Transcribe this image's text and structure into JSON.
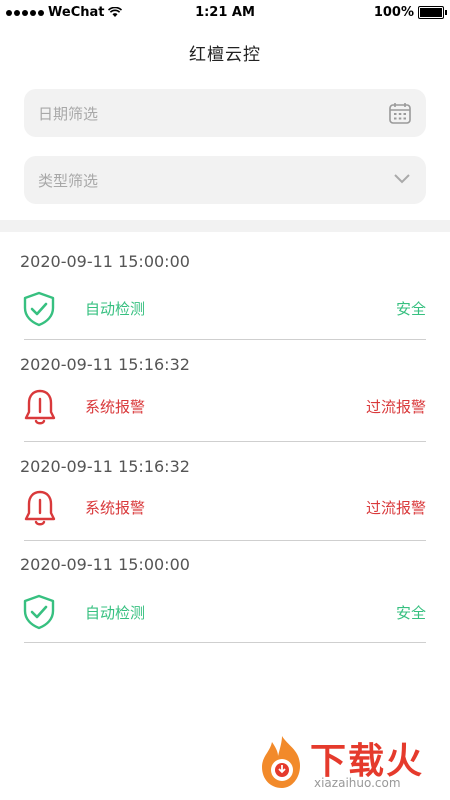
{
  "status_bar": {
    "carrier": "WeChat",
    "time": "1:21 AM",
    "battery": "100%"
  },
  "header": {
    "title": "红檀云控"
  },
  "filters": {
    "date_placeholder": "日期筛选",
    "type_placeholder": "类型筛选",
    "date_icon": "calendar-icon",
    "type_icon": "chevron-down-icon"
  },
  "records": [
    {
      "time": "2020-09-11  15:00:00",
      "type": "自动检测",
      "status": "安全",
      "icon": "shield-check-icon",
      "color": "#37c080"
    },
    {
      "time": "2020-09-11  15:16:32",
      "type": "系统报警",
      "status": "过流报警",
      "icon": "bell-icon",
      "color": "#d9393b"
    },
    {
      "time": "2020-09-11  15:16:32",
      "type": "系统报警",
      "status": "过流报警",
      "icon": "bell-icon",
      "color": "#d9393b"
    },
    {
      "time": "2020-09-11  15:00:00",
      "type": "自动检测",
      "status": "安全",
      "icon": "shield-check-icon",
      "color": "#37c080"
    }
  ],
  "watermark": {
    "text": "下载火",
    "sub": "xiazaihuo.com"
  }
}
